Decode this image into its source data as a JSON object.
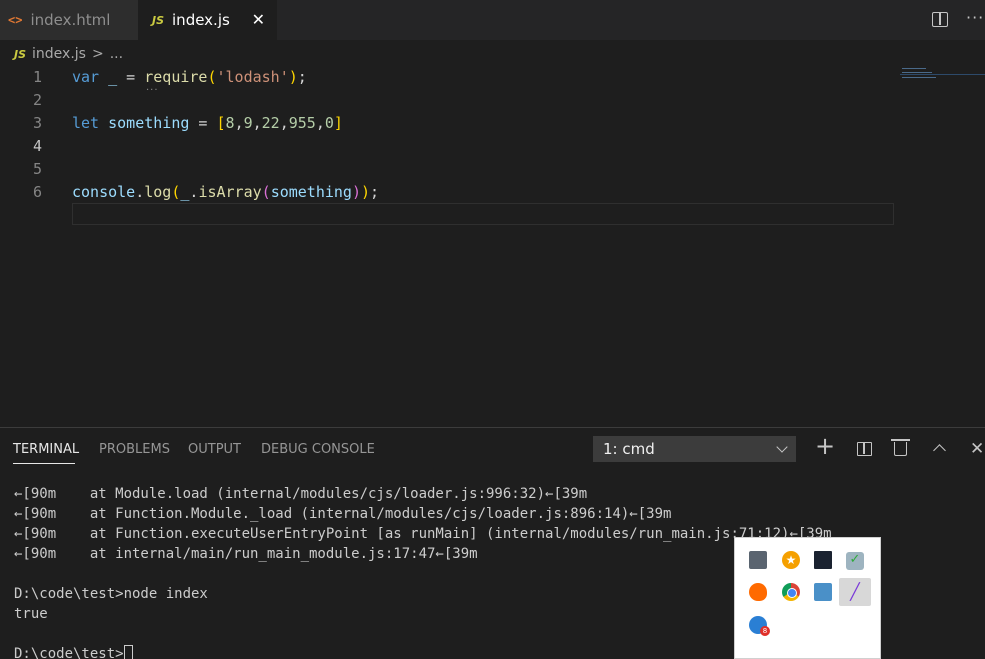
{
  "tabs": [
    {
      "icon": "<>",
      "label": "index.html"
    },
    {
      "icon": "JS",
      "label": "index.js",
      "close": "✕"
    }
  ],
  "breadcrumb": {
    "icon": "JS",
    "file": "index.js",
    "sep": ">",
    "rest": "..."
  },
  "editor": {
    "line_numbers": [
      "1",
      "2",
      "3",
      "4",
      "5",
      "6"
    ],
    "active_line": 4,
    "code": [
      {
        "t1": "var",
        "t2": "_",
        "t3": " = ",
        "t4": "require",
        "t5": "(",
        "t6": "'lodash'",
        "t7": ")",
        "t8": ";"
      },
      {},
      {
        "t1": "let",
        "t2": "something",
        "t3": " = ",
        "t4": "[",
        "n": [
          "8",
          "9",
          "22",
          "955",
          "0"
        ],
        "t5": "]"
      },
      {},
      {},
      {
        "t1": "console",
        "t2": ".",
        "t3": "log",
        "t4": "(",
        "t5": "_",
        "t6": ".",
        "t7": "isArray",
        "t8": "(",
        "t9": "something",
        "t10": ")",
        "t11": ")",
        "t12": ";"
      }
    ],
    "hint_dots": "..."
  },
  "panel": {
    "tabs": [
      "TERMINAL",
      "PROBLEMS",
      "OUTPUT",
      "DEBUG CONSOLE"
    ],
    "terminal_select": "1: cmd",
    "icons": [
      "plus-icon",
      "split-terminal-icon",
      "trash-icon",
      "chevron-up-icon",
      "close-icon"
    ],
    "terminal_lines": [
      "←[90m    at Module.load (internal/modules/cjs/loader.js:996:32)←[39m",
      "←[90m    at Function.Module._load (internal/modules/cjs/loader.js:896:14)←[39m",
      "←[90m    at Function.executeUserEntryPoint [as runMain] (internal/modules/run_main.js:71:12)←[39m",
      "←[90m    at internal/main/run_main_module.js:17:47←[39m",
      "",
      "D:\\code\\test>node index",
      "true",
      "",
      "D:\\code\\test>"
    ]
  },
  "tray": {
    "icons": [
      "monitor-icon",
      "star-icon",
      "screen-icon",
      "check-icon",
      "avast-icon",
      "chrome-icon",
      "network-icon",
      "pen-icon",
      "badge-icon"
    ],
    "badge_count": "8"
  }
}
